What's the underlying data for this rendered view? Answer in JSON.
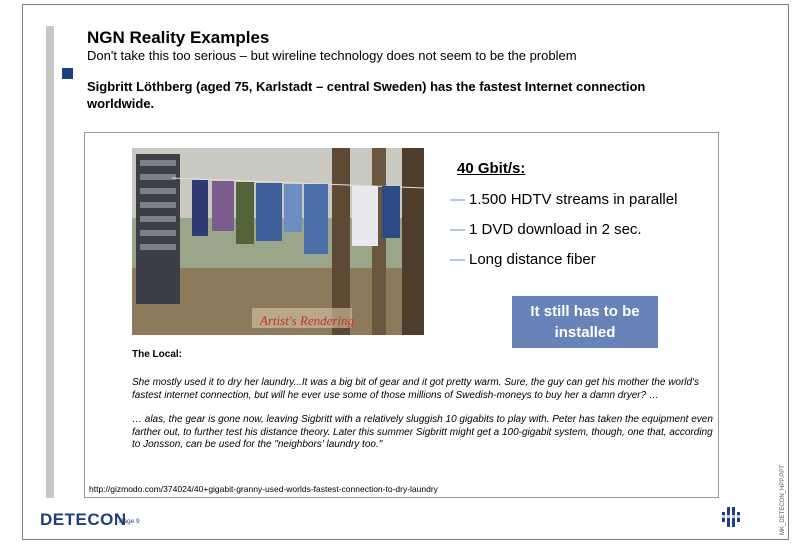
{
  "slide": {
    "title": "NGN Reality Examples",
    "subtitle": "Don't take this too serious – but wireline technology does not seem to be the problem",
    "lead": "Sigbritt Löthberg (aged 75, Karlstadt – central Sweden) has the fastest Internet connection worldwide."
  },
  "photo": {
    "caption": "Artist's Rendering"
  },
  "speed": {
    "title": "40 Gbit/s:",
    "items": [
      "1.500 HDTV streams in parallel",
      "1 DVD download in 2 sec.",
      "Long distance fiber"
    ]
  },
  "callout": "It still has to be installed",
  "local": {
    "heading": "The Local:",
    "quote1": "She mostly used it to dry her laundry...It was a big bit of gear and it got pretty warm. Sure, the guy can get his mother the world's fastest internet connection, but will he ever use some of those millions of Swedish-moneys to buy her a damn dryer? …",
    "quote2": "… alas, the gear is gone now, leaving Sigbritt with a relatively sluggish 10 gigabits to play with. Peter has taken the equipment even farther out, to further test his distance theory. Later this summer Sigbritt might get a 100-gigabit system, though, one that, according to Jonsson, can be used for the \"neighbors' laundry too.\""
  },
  "source_url": "http://gizmodo.com/374024/40+gigabit-granny-used-worlds-fastest-connection-to-dry-laundry",
  "footer": {
    "logo": "DETECON",
    "page": "Page 9",
    "file_code": "MK_DETECON_HPP.PPT"
  },
  "colors": {
    "accent": "#1f3f7f",
    "callout": "#6783b8",
    "dash": "#6f8fcf"
  }
}
